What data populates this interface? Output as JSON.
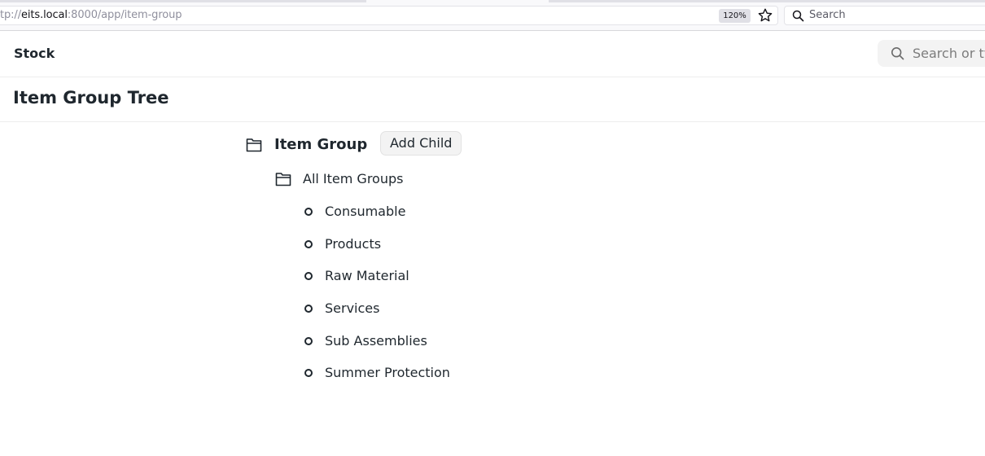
{
  "browser": {
    "url_prefix": "tp://",
    "url_host": "eits.local",
    "url_rest": ":8000/app/item-group",
    "zoom": "120%",
    "search_placeholder": "Search"
  },
  "navbar": {
    "brand": "Stock",
    "search_placeholder": "Search or ty"
  },
  "page": {
    "title": "Item Group Tree"
  },
  "tree": {
    "root_label": "Item Group",
    "add_child_label": "Add Child",
    "group_label": "All Item Groups",
    "leaves": [
      "Consumable",
      "Products",
      "Raw Material",
      "Services",
      "Sub Assemblies",
      "Summer Protection"
    ]
  },
  "icons": {
    "root": "folder-open-icon",
    "group": "folder-open-icon",
    "leaf": "circle-dot-icon"
  }
}
